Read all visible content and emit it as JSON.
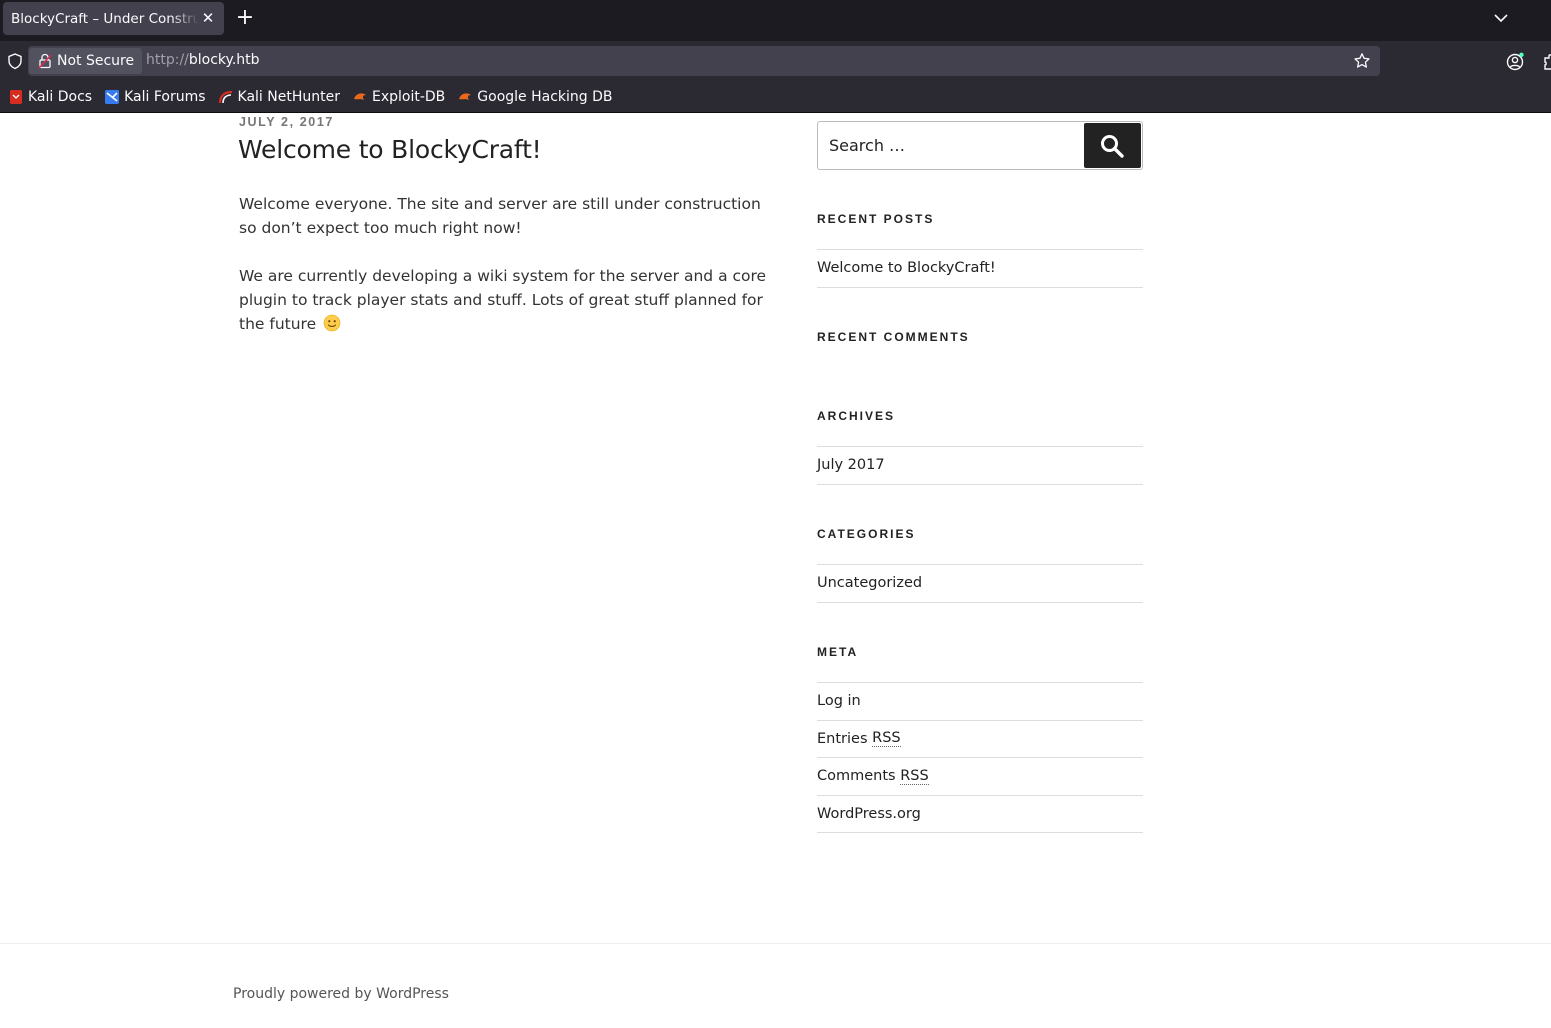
{
  "browser": {
    "tab_title": "BlockyCraft – Under Construction!",
    "not_secure_label": "Not Secure",
    "url_scheme": "http://",
    "url_host": "blocky.htb",
    "bookmarks": [
      {
        "label": "Kali Docs",
        "icon": "kali-docs-icon"
      },
      {
        "label": "Kali Forums",
        "icon": "kali-forums-icon"
      },
      {
        "label": "Kali NetHunter",
        "icon": "kali-nethunter-icon"
      },
      {
        "label": "Exploit-DB",
        "icon": "exploit-db-icon"
      },
      {
        "label": "Google Hacking DB",
        "icon": "google-hacking-db-icon"
      }
    ]
  },
  "post": {
    "date": "JULY 2, 2017",
    "title": "Welcome to BlockyCraft!",
    "paragraphs": [
      "Welcome everyone. The site and server are still under construction so don’t expect too much right now!",
      "We are currently developing a wiki system for the server and a core plugin to track player stats and stuff. Lots of great stuff planned for the future"
    ]
  },
  "sidebar": {
    "search_placeholder": "Search …",
    "recent_posts": {
      "title": "RECENT POSTS",
      "items": [
        "Welcome to BlockyCraft!"
      ]
    },
    "recent_comments": {
      "title": "RECENT COMMENTS"
    },
    "archives": {
      "title": "ARCHIVES",
      "items": [
        "July 2017"
      ]
    },
    "categories": {
      "title": "CATEGORIES",
      "items": [
        "Uncategorized"
      ]
    },
    "meta": {
      "title": "META",
      "login": "Log in",
      "entries_prefix": "Entries",
      "comments_prefix": "Comments",
      "rss": "RSS",
      "wordpress": "WordPress.org"
    }
  },
  "footer": {
    "text": "Proudly powered by WordPress"
  },
  "colors": {
    "chrome_dark": "#1c1b22",
    "toolbar": "#2b2a33",
    "text": "#222222"
  }
}
